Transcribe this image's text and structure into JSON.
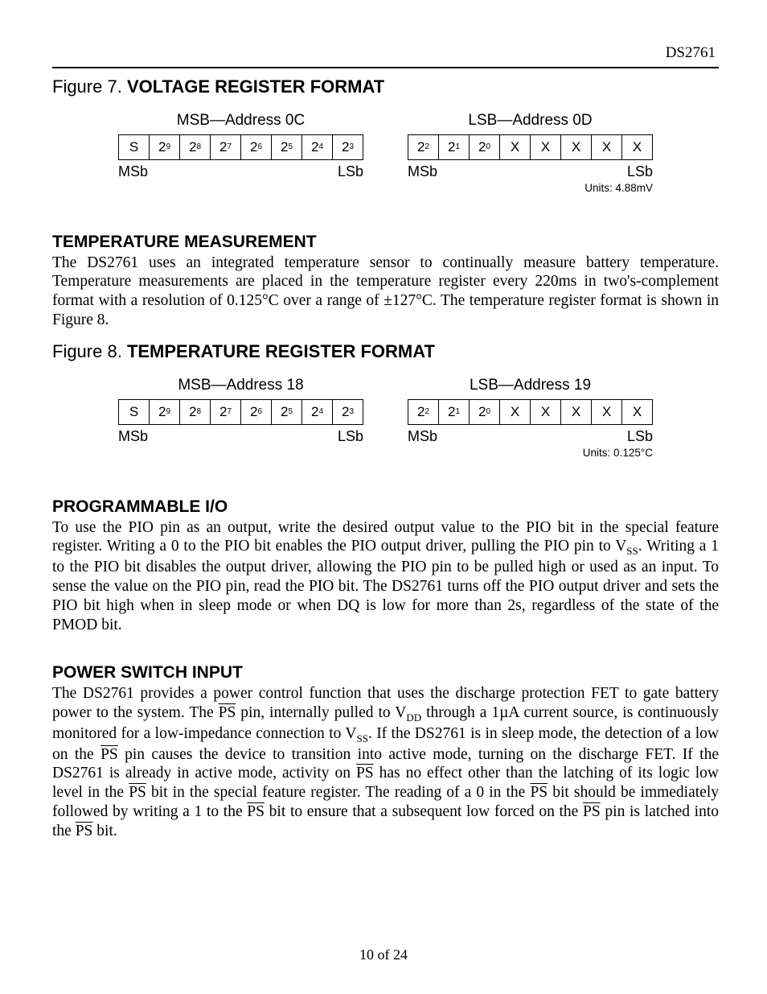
{
  "header": {
    "part": "DS2761"
  },
  "fig7": {
    "prefix": "Figure 7. ",
    "title": "VOLTAGE REGISTER FORMAT",
    "msb": {
      "label": "MSB—Address 0C",
      "cells": [
        "S",
        "2|9",
        "2|8",
        "2|7",
        "2|6",
        "2|5",
        "2|4",
        "2|3"
      ],
      "left": "MSb",
      "right": "LSb"
    },
    "lsb": {
      "label": "LSB—Address 0D",
      "cells": [
        "2|2",
        "2|1",
        "2|0",
        "X",
        "X",
        "X",
        "X",
        "X"
      ],
      "left": "MSb",
      "right": "LSb",
      "units": "Units: 4.88mV"
    }
  },
  "temp_section": {
    "heading": "TEMPERATURE MEASUREMENT",
    "body": "The DS2761 uses an integrated temperature sensor to continually measure battery temperature. Temperature measurements are placed in the temperature register every 220ms in two's-complement format with a resolution of 0.125°C over a range of ±127°C. The temperature register format is shown in Figure 8."
  },
  "fig8": {
    "prefix": "Figure 8. ",
    "title": "TEMPERATURE REGISTER FORMAT",
    "msb": {
      "label": "MSB—Address 18",
      "cells": [
        "S",
        "2|9",
        "2|8",
        "2|7",
        "2|6",
        "2|5",
        "2|4",
        "2|3"
      ],
      "left": "MSb",
      "right": "LSb"
    },
    "lsb": {
      "label": "LSB—Address 19",
      "cells": [
        "2|2",
        "2|1",
        "2|0",
        "X",
        "X",
        "X",
        "X",
        "X"
      ],
      "left": "MSb",
      "right": "LSb",
      "units": "Units: 0.125°C"
    }
  },
  "pio_section": {
    "heading": "PROGRAMMABLE I/O",
    "body_html": "To use the PIO pin as an output, write the desired output value to the PIO bit in the special feature register. Writing a 0 to the PIO bit enables the PIO output driver, pulling the PIO pin to V<span class='sub'>SS</span>. Writing a 1 to the PIO bit disables the output driver, allowing the PIO pin to be pulled high or used as an input. To sense the value on the PIO pin, read the PIO bit. The DS2761 turns off the PIO output driver and sets the PIO bit high when in sleep mode or when DQ is low for more than 2s, regardless of the state of the PMOD bit."
  },
  "ps_section": {
    "heading": "POWER SWITCH INPUT",
    "body_html": "The DS2761 provides a power control function that uses the discharge protection FET to gate battery power to the system. The <span class='overline'>PS</span> pin, internally pulled to V<span class='sub'>DD</span> through a 1µA current source, is continuously monitored for a low-impedance connection to V<span class='sub'>SS</span>. If the DS2761 is in sleep mode, the detection of a low on the <span class='overline'>PS</span> pin causes the device to transition into active mode, turning on the discharge FET. If the DS2761 is already in active mode, activity on <span class='overline'>PS</span> has no effect other than the latching of its logic low level in the <span class='overline'>PS</span> bit in the special feature register. The reading of a 0 in the <span class='overline'>PS</span> bit should be immediately followed by writing a 1 to the <span class='overline'>PS</span> bit to ensure that a subsequent low forced on the <span class='overline'>PS</span> pin is latched into the <span class='overline'>PS</span> bit."
  },
  "footer": {
    "text": "10 of 24"
  }
}
